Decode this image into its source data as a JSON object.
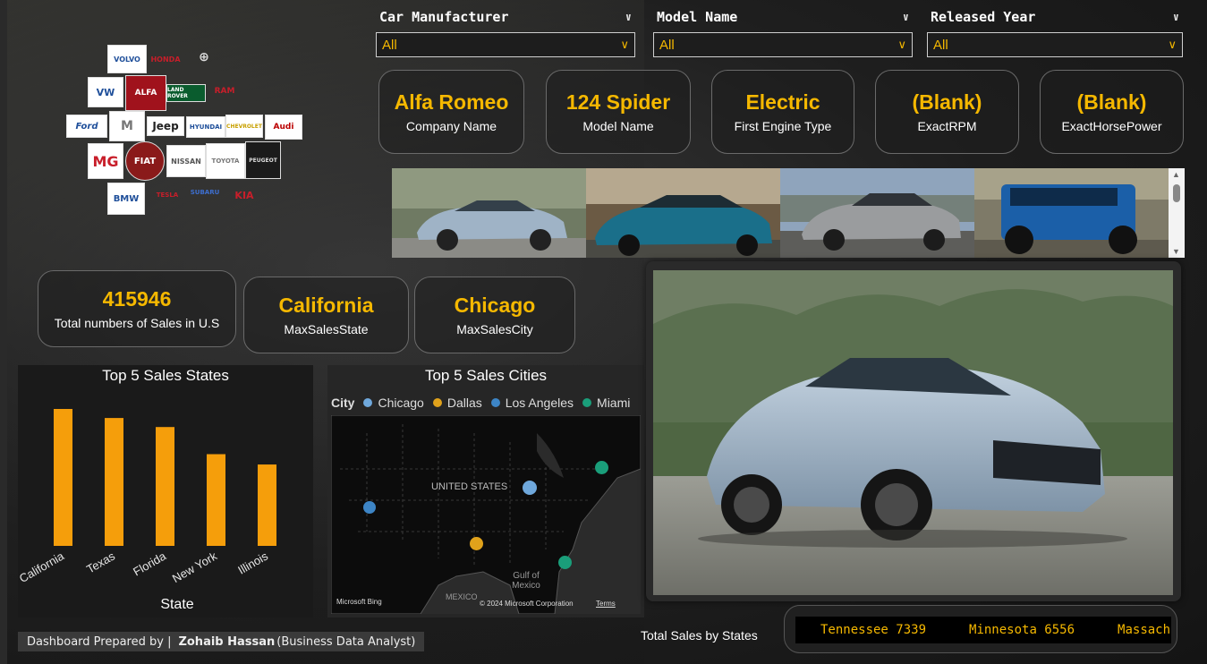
{
  "slicers": [
    {
      "title": "Car Manufacturer",
      "value": "All"
    },
    {
      "title": "Model Name",
      "value": "All"
    },
    {
      "title": "Released Year",
      "value": "All"
    }
  ],
  "kpis_top": [
    {
      "value": "Alfa Romeo",
      "label": "Company Name"
    },
    {
      "value": "124 Spider",
      "label": "Model Name"
    },
    {
      "value": "Electric",
      "label": "First Engine Type"
    },
    {
      "value": "(Blank)",
      "label": "ExactRPM"
    },
    {
      "value": "(Blank)",
      "label": "ExactHorsePower"
    }
  ],
  "kpis_mid": [
    {
      "value": "415946",
      "label": "Total numbers of Sales in U.S"
    },
    {
      "value": "California",
      "label": "MaxSalesState"
    },
    {
      "value": "Chicago",
      "label": "MaxSalesCity"
    }
  ],
  "logos": [
    {
      "text": "VOLVO"
    },
    {
      "text": "HONDA"
    },
    {
      "text": "⊕"
    },
    {
      "text": "VW"
    },
    {
      "text": "ALFA"
    },
    {
      "text": "LAND ROVER"
    },
    {
      "text": "RAM"
    },
    {
      "text": "Ford"
    },
    {
      "text": "M"
    },
    {
      "text": "Jeep"
    },
    {
      "text": "HYUNDAI"
    },
    {
      "text": "CHEVROLET"
    },
    {
      "text": "Audi"
    },
    {
      "text": "MG"
    },
    {
      "text": "FIAT"
    },
    {
      "text": "NISSAN"
    },
    {
      "text": "TOYOTA"
    },
    {
      "text": "PEUGEOT"
    },
    {
      "text": "BMW"
    },
    {
      "text": "TESLA"
    },
    {
      "text": "SUBARU"
    },
    {
      "text": "KIA"
    }
  ],
  "chart_data": {
    "type": "bar",
    "title": "Top 5 Sales States",
    "xlabel": "State",
    "ylabel": "",
    "categories": [
      "California",
      "Texas",
      "Florida",
      "New York",
      "Illinois"
    ],
    "values": [
      10600,
      9900,
      9200,
      7100,
      6300
    ],
    "ylim": [
      0,
      11500
    ],
    "color": "#f59e0b"
  },
  "map": {
    "title": "Top 5 Sales Cities",
    "legend_title": "City",
    "legend": [
      {
        "name": "Chicago",
        "color": "#6fa8dc"
      },
      {
        "name": "Dallas",
        "color": "#e0a21b"
      },
      {
        "name": "Los Angeles",
        "color": "#3d85c6"
      },
      {
        "name": "Miami",
        "color": "#1a9e7a"
      }
    ],
    "country_label": "UNITED STATES",
    "gulf_label": "Gulf of Mexico",
    "mexico_label": "MEXICO",
    "bing": "Microsoft Bing",
    "copyright": "© 2024 Microsoft Corporation",
    "terms": "Terms"
  },
  "ticker": {
    "label": "Total Sales by States",
    "items": [
      "Tennessee 7339",
      "Minnesota 6556",
      "Massachu"
    ]
  },
  "footer": {
    "prefix": "Dashboard Prepared by |",
    "name": "Zohaib Hassan",
    "role": "(Business Data Analyst)"
  },
  "colors": {
    "accent": "#f5b800",
    "bar": "#f59e0b"
  }
}
